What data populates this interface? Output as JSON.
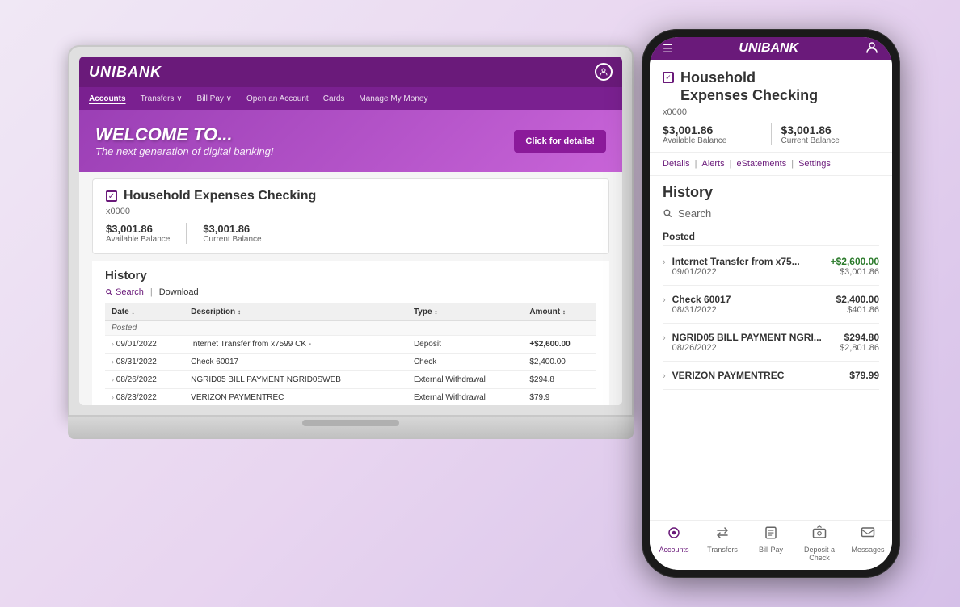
{
  "scene": {
    "background": "linear-gradient(135deg, #f0e8f5, #d5c0e8)"
  },
  "laptop": {
    "logo": "UNIBANK",
    "nav": {
      "items": [
        "Accounts",
        "Transfers ∨",
        "Bill Pay ∨",
        "Open an Account",
        "Cards",
        "Manage My Money"
      ]
    },
    "banner": {
      "line1": "WELCOME TO...",
      "line2": "The next generation of digital banking!",
      "button": "Click for details!"
    },
    "account": {
      "name": "Household Expenses Checking",
      "number": "x0000",
      "available_balance_amount": "$3,001.86",
      "available_balance_label": "Available Balance",
      "current_balance_amount": "$3,001.86",
      "current_balance_label": "Current Balance"
    },
    "history": {
      "title": "History",
      "search_label": "Search",
      "download_label": "Download",
      "table": {
        "columns": [
          "Date",
          "Description",
          "Type",
          "Amount"
        ],
        "posted_label": "Posted",
        "rows": [
          {
            "date": "09/01/2022",
            "description": "Internet Transfer from x7599 CK -",
            "type": "Deposit",
            "amount": "+$2,600.00",
            "positive": true
          },
          {
            "date": "08/31/2022",
            "description": "Check 60017",
            "type": "Check",
            "amount": "$2,400.00",
            "positive": false
          },
          {
            "date": "08/26/2022",
            "description": "NGRID05 BILL PAYMENT NGRID0SWEB",
            "type": "External Withdrawal",
            "amount": "$294.8",
            "positive": false
          },
          {
            "date": "08/23/2022",
            "description": "VERIZON PAYMENTREC",
            "type": "External Withdrawal",
            "amount": "$79.9",
            "positive": false
          }
        ]
      }
    }
  },
  "phone": {
    "logo": "UNIBANK",
    "account": {
      "name_line1": "Household",
      "name_line2": "Expenses Checking",
      "number": "x0000",
      "available_balance_amount": "$3,001.86",
      "available_balance_label": "Available Balance",
      "current_balance_amount": "$3,001.86",
      "current_balance_label": "Current Balance"
    },
    "account_links": [
      "Details",
      "Alerts",
      "eStatements",
      "Settings"
    ],
    "history": {
      "title": "History",
      "search_placeholder": "Search",
      "posted_label": "Posted",
      "transactions": [
        {
          "description": "Internet Transfer from x75...",
          "date": "09/01/2022",
          "amount": "+$2,600.00",
          "balance": "$3,001.86",
          "positive": true
        },
        {
          "description": "Check 60017",
          "date": "08/31/2022",
          "amount": "$2,400.00",
          "balance": "$401.86",
          "positive": false
        },
        {
          "description": "NGRID05 BILL PAYMENT NGRI...",
          "date": "08/26/2022",
          "amount": "$294.80",
          "balance": "$2,801.86",
          "positive": false
        },
        {
          "description": "VERIZON PAYMENTREC",
          "date": "",
          "amount": "$79.99",
          "balance": "",
          "positive": false
        }
      ]
    },
    "bottom_nav": [
      {
        "label": "Accounts",
        "icon": "⊙"
      },
      {
        "label": "Transfers",
        "icon": "⇄"
      },
      {
        "label": "Bill Pay",
        "icon": "📄"
      },
      {
        "label": "Deposit a Check",
        "icon": "📷"
      },
      {
        "label": "Messages",
        "icon": "✉"
      }
    ]
  }
}
